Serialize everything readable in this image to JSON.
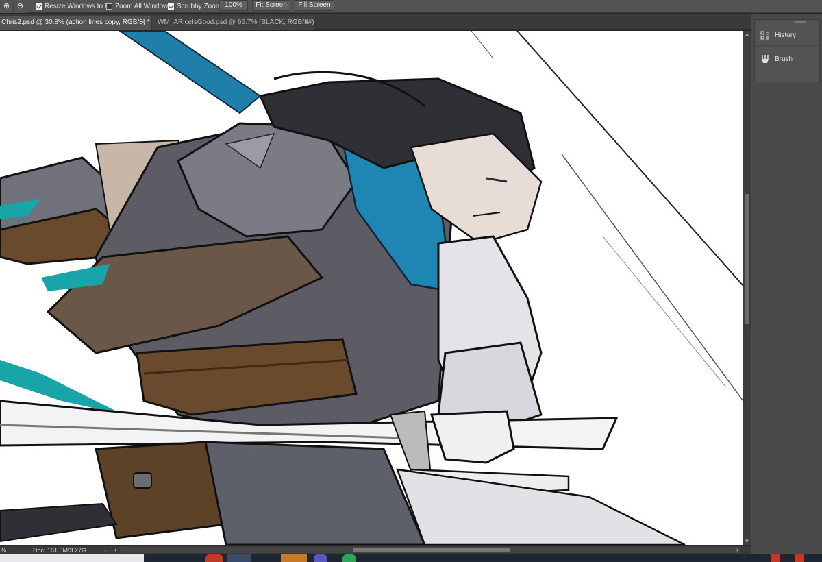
{
  "options_bar": {
    "zoom_in_icon": "zoom-in-icon",
    "zoom_out_icon": "zoom-out-icon",
    "resize_windows_to_fit": {
      "label": "Resize Windows to Fit",
      "checked": true
    },
    "zoom_all_windows": {
      "label": "Zoom All Windows",
      "checked": false
    },
    "scrubby_zoom": {
      "label": "Scrubby Zoom",
      "checked": true
    },
    "buttons": {
      "actual": "100%",
      "fit_screen": "Fit Screen",
      "fill_screen": "Fill Screen"
    }
  },
  "tabs": [
    {
      "label": "Chris2.psd @ 30.8% (action lines copy, RGB/8) *",
      "active": true,
      "close": "×"
    },
    {
      "label": "WM_ARiceIsGood.psd @ 66.7% (BLACK, RGB/8#)",
      "active": false,
      "close": "×"
    }
  ],
  "status_bar": {
    "zoom": "%",
    "doc_label": "Doc: 161.5M/3.27G",
    "arrow": "›",
    "scroll_left": "‹",
    "scroll_right": "›"
  },
  "panels": [
    {
      "label": "History",
      "icon": "history-icon"
    },
    {
      "label": "Brush",
      "icon": "brush-icon"
    }
  ],
  "colors": {
    "ui_dark": "#535353",
    "canvas": "#ffffff",
    "scarf_blue": "#1f7fa8",
    "armor_grey": "#6d6e78",
    "leather_brown": "#6a4a2c",
    "teal_accent": "#19a5a8"
  }
}
